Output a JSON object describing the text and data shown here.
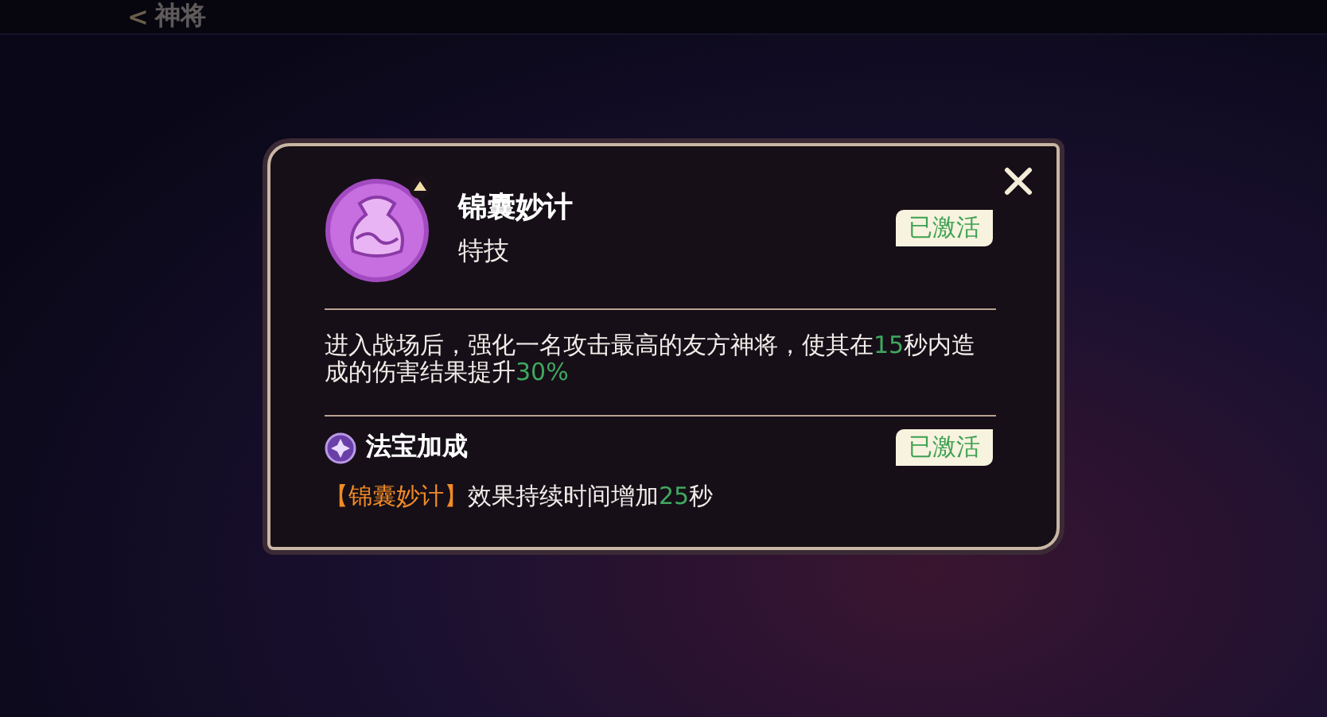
{
  "header": {
    "back_icon": "<",
    "title": "神将"
  },
  "dialog": {
    "skill": {
      "name": "锦囊妙计",
      "type": "特技",
      "status": "已激活",
      "activated": true
    },
    "description": [
      {
        "kind": "text",
        "text": "进入战场后，强化一名攻击最高的友方神将，使其在"
      },
      {
        "kind": "value",
        "text": "15"
      },
      {
        "kind": "text",
        "text": "秒内造成的伤害结果提升"
      },
      {
        "kind": "value",
        "text": "30%"
      }
    ],
    "bonus": {
      "title": "法宝加成",
      "status": "已激活",
      "activated": true,
      "effect": [
        {
          "kind": "ref",
          "text": "【锦囊妙计】"
        },
        {
          "kind": "text",
          "text": "效果持续时间增加"
        },
        {
          "kind": "value",
          "text": "25"
        },
        {
          "kind": "text",
          "text": "秒"
        }
      ]
    }
  }
}
